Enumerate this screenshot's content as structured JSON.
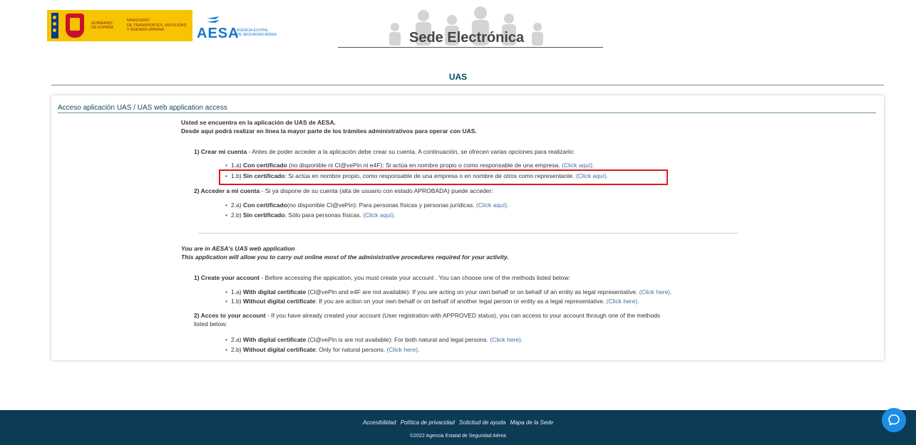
{
  "header": {
    "gov": {
      "line1": "GOBIERNO",
      "line2": "DE ESPAÑA"
    },
    "ministry": {
      "line1": "MINISTERIO",
      "line2": "DE TRANSPORTES, MOVILIDAD",
      "line3": "Y AGENDA URBANA"
    },
    "aesa": {
      "word": "AESA",
      "sub1": "AGENCIA ESTATAL",
      "sub2": "DE SEGURIDAD AÉREA"
    },
    "sede_title": "Sede Electrónica"
  },
  "page_title": "UAS",
  "section_title": "Acceso aplicación UAS / UAS web application access",
  "es": {
    "intro1": "Usted se encuentra en la aplicación de UAS de AESA.",
    "intro2": "Desde aquí podrá realizar en línea la mayor parte de los trámites administrativos para operar con UAS.",
    "step1_head": "1) Crear mi cuenta",
    "step1_text": " - Antes de poder acceder a la aplicación debe crear su cuenta. A continuación, se ofrecen varias opciones para realizarlo:",
    "opt1a_prefix": "1.a) ",
    "opt1a_bold": "Con certificado",
    "opt1a_text": " (no disponible ni Cl@vePin ni e4F): Si actúa en nombre propio o como responsable de una empresa. ",
    "opt1a_link": "(Click aquí).",
    "opt1b_prefix": "1.b) ",
    "opt1b_bold": "Sin certificado",
    "opt1b_text": ": Si actúa en nombre propio, como responsable de una empresa o en nombre de otros como representante. ",
    "opt1b_link": "(Click aquí).",
    "step2_head": "2) Acceder a mi cuenta",
    "step2_text": " - Si ya dispone de su cuenta (alta de usuario con estado APROBADA) puede acceder:",
    "opt2a_prefix": "2.a) ",
    "opt2a_bold": "Con certificado",
    "opt2a_text": "(no disponible Cl@vePin): Para personas físicas y personas jurídicas. ",
    "opt2a_link": "(Click aquí).",
    "opt2b_prefix": "2.b) ",
    "opt2b_bold": "Sin certificado",
    "opt2b_text": ": Sólo para personas físicas. ",
    "opt2b_link": "(Click aquí)."
  },
  "en": {
    "intro1": "You are in AESA's UAS web application",
    "intro2": "This application will allow you to carry out online most of the administrative procedures required for your activity.",
    "step1_head": "1) Create your account",
    "step1_text": " - Before accessing the appication, you must create your account . You can choose one of the methods listed below:",
    "opt1a_prefix": "1.a) ",
    "opt1a_bold": "With digital certificate",
    "opt1a_text": " (Cl@vePin and e4F are not available): If you are acting on your own behalf or on behalf of an entity as legal representative. ",
    "opt1a_link": "(Click here).",
    "opt1b_prefix": "1.b) ",
    "opt1b_bold": "Without digital certificate",
    "opt1b_text": ": If you are action on your own behalf or on behalf of another legal person or entity as a legal representative. ",
    "opt1b_link": "(Click here).",
    "step2_head": "2) Acces to your account",
    "step2_text_line1": " - If you have already created your account (User registration with APPROVED status), you can access to your account through one of the methods",
    "step2_text_line2": "listed below:",
    "opt2a_prefix": "2.a) ",
    "opt2a_bold": "With digital certificate",
    "opt2a_text": " (Cl@vePin is are not available): For both natural and legal persons. ",
    "opt2a_link": "(Click here).",
    "opt2b_prefix": "2.b) ",
    "opt2b_bold": "Without digital certificate",
    "opt2b_text": ": Only for natural persons. ",
    "opt2b_link": "(Click here)."
  },
  "footer": {
    "links": [
      "Accesibilidad",
      "Política de privacidad",
      "Solicitud de ayuda",
      "Mapa de la Sede"
    ],
    "copyright": "©2022 Agencia Estatal de Seguridad Aérea"
  },
  "colors": {
    "brand_dark": "#0c3b56",
    "link": "#3d6fa8",
    "highlight": "#e3171b",
    "chat": "#1b8ee8"
  },
  "icons": {
    "chat": "chat-bubble-icon"
  }
}
